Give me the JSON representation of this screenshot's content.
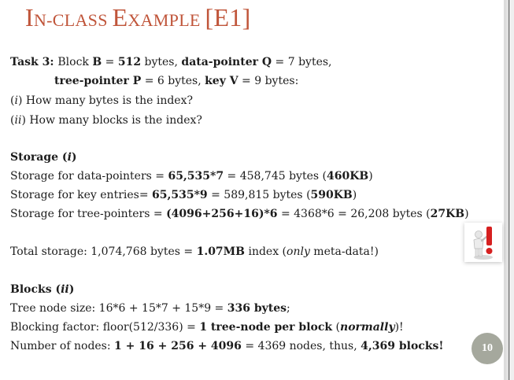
{
  "slide": {
    "title": {
      "initial1": "I",
      "rest1": "N-CLASS ",
      "initial2": "E",
      "rest2": "XAMPLE ",
      "tag": "[E1]"
    },
    "page_number": "10"
  },
  "task": {
    "l1": [
      "Task 3: ",
      "Block ",
      "B",
      " = ",
      "512",
      " bytes, ",
      "data-pointer ",
      "Q",
      " = 7 bytes,"
    ],
    "l2": [
      "tree-pointer ",
      "P",
      " =  6 bytes, ",
      "key ",
      "V",
      " = 9 bytes:"
    ],
    "q1": [
      "(",
      "i",
      ") How many bytes is the index?"
    ],
    "q2": [
      "(",
      "ii",
      ") How many blocks is the index?"
    ]
  },
  "storage": {
    "heading": [
      "Storage (",
      "i",
      ")"
    ],
    "l1": [
      "Storage for data-pointers = ",
      "65,535*7",
      " = 458,745 bytes (",
      "460KB",
      ")"
    ],
    "l2": [
      "Storage for key entries= ",
      "65,535*9",
      " = 589,815 bytes (",
      "590KB",
      ")"
    ],
    "l3": [
      "Storage for tree-pointers = ",
      "(4096+256+16)*6",
      " = 4368*6 = 26,208 bytes (",
      "27KB",
      ")"
    ],
    "total": [
      "Total storage: 1,074,768 bytes = ",
      " 1.07MB",
      " index (",
      "only",
      " meta-data!)"
    ]
  },
  "blocks": {
    "heading": [
      "Blocks (",
      "ii",
      ")"
    ],
    "l1": [
      "Tree node size: 16*6 + 15*7 + 15*9 = ",
      "336 bytes",
      ";"
    ],
    "l2": [
      "Blocking factor: floor(512/336) = ",
      "1 tree-node per block",
      " (",
      "normally",
      ")!"
    ],
    "l3": [
      "Number of nodes: ",
      "1 + 16 + 256 + 4096",
      " = 4369 nodes, thus, ",
      "4,369 blocks!"
    ]
  },
  "icons": {
    "decoration": "alert-person-icon"
  },
  "colors": {
    "title": "#c0553a",
    "page_badge": "#a5a89d",
    "exclamation": "#d62020"
  }
}
